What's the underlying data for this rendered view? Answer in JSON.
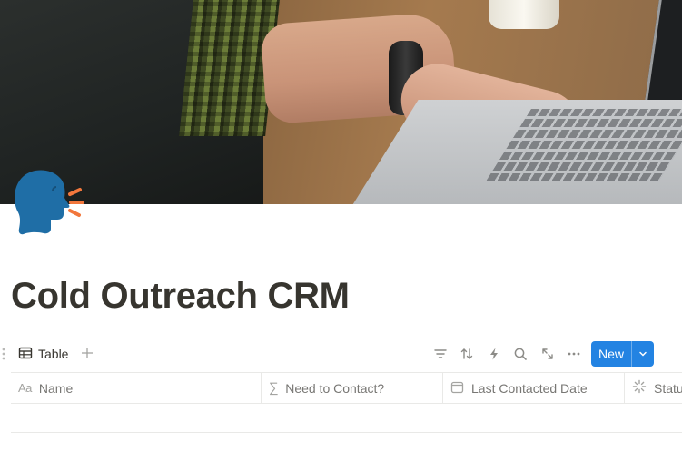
{
  "page": {
    "title": "Cold Outreach CRM",
    "icon": "speaking-head-icon",
    "cover": "person-typing-on-laptop-photo"
  },
  "view": {
    "tab_label": "Table",
    "tab_icon": "table-icon",
    "add_view_icon": "plus-icon"
  },
  "toolbar": {
    "icons": [
      "filter-icon",
      "sort-icon",
      "lightning-icon",
      "search-icon",
      "expand-icon",
      "more-icon"
    ],
    "new_label": "New",
    "new_caret_icon": "chevron-down-icon",
    "accent": "#2383e2"
  },
  "table": {
    "columns": [
      {
        "label": "Name",
        "type_icon": "Aa"
      },
      {
        "label": "Need to Contact?",
        "type_icon": "∑"
      },
      {
        "label": "Last Contacted Date",
        "type_icon": "calendar-icon"
      },
      {
        "label": "Status",
        "type_icon": "status-icon"
      }
    ],
    "rows": []
  },
  "colors": {
    "text": "#37352f",
    "muted": "#787774",
    "border": "#e9e9e7",
    "icon_head": "#1f6ea6",
    "icon_sound": "#f2773c"
  }
}
